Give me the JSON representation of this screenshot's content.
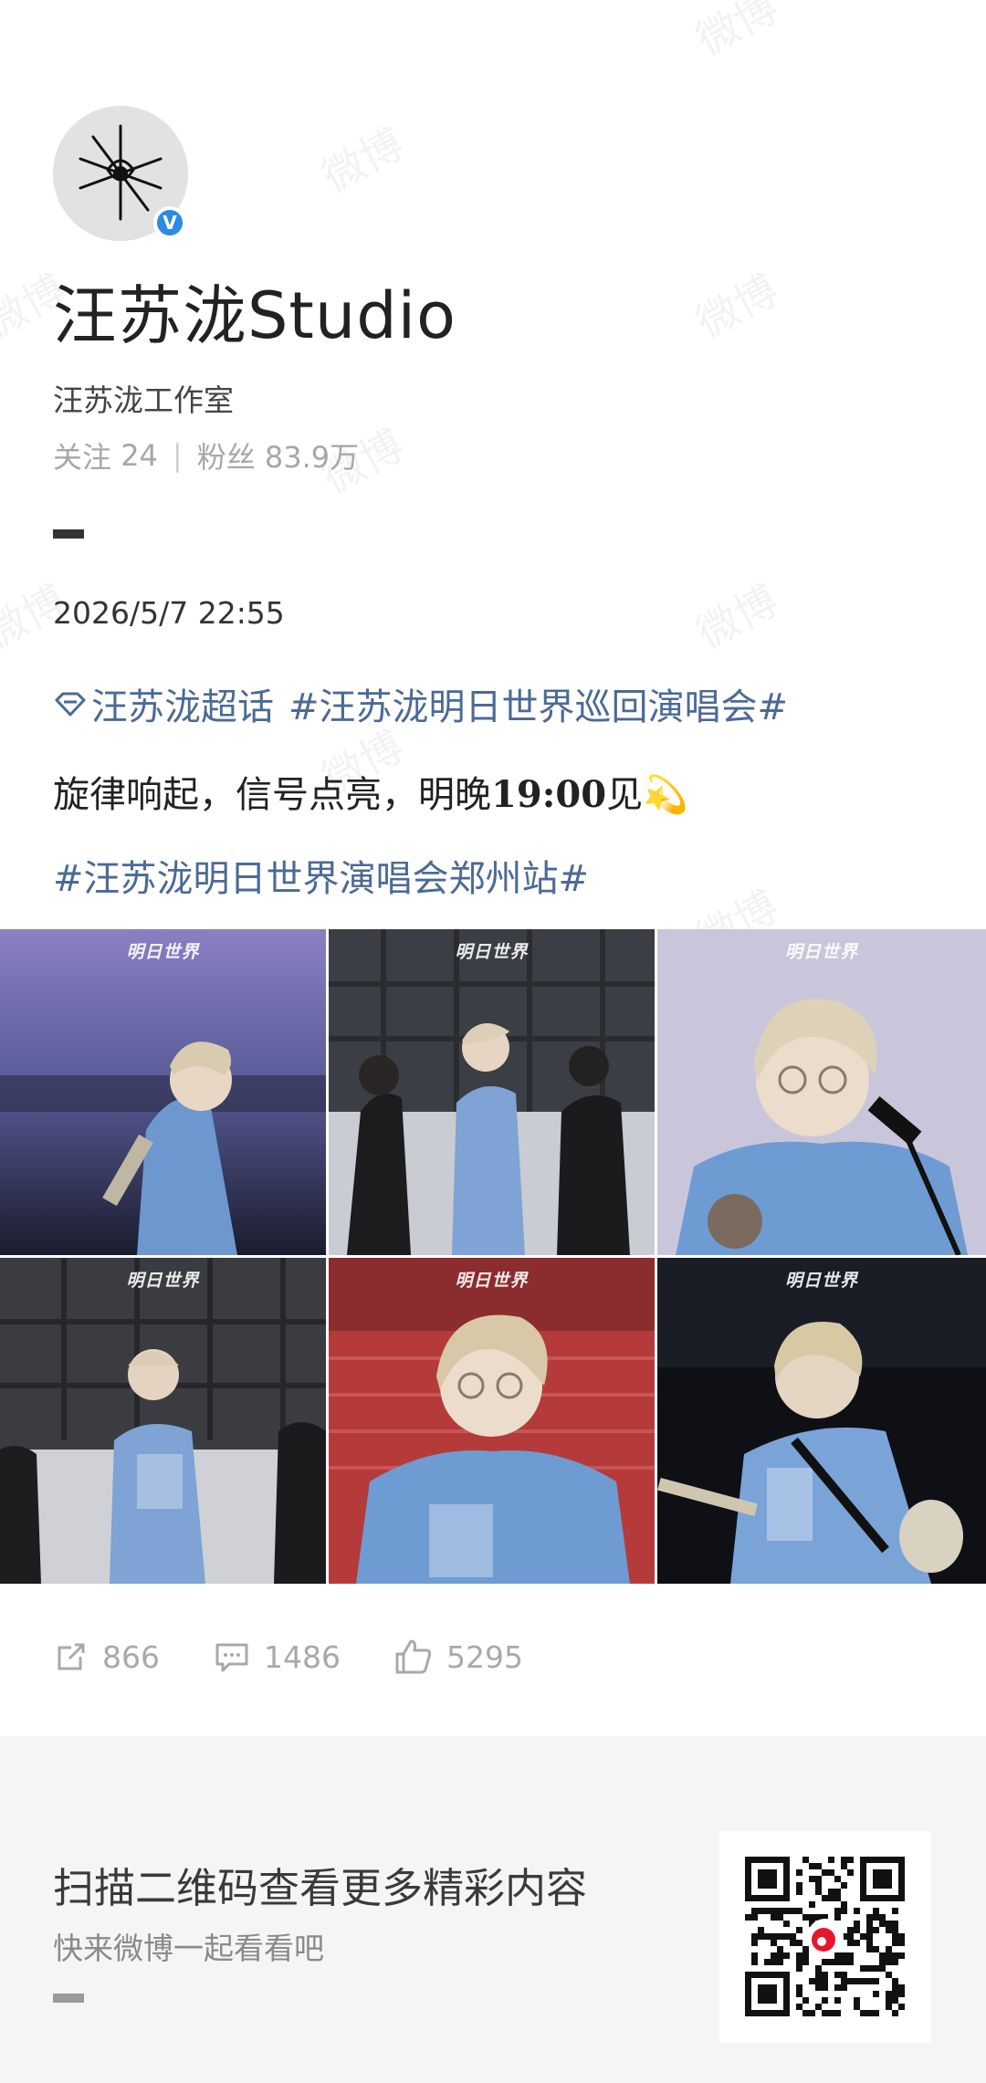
{
  "profile": {
    "name": "汪苏泷Studio",
    "description": "汪苏泷工作室",
    "following_label": "关注",
    "following_count": "24",
    "followers_label": "粉丝",
    "followers_count": "83.9万",
    "verified_badge": "V"
  },
  "post": {
    "date": "2026/5/7 22:55",
    "topic_link": "汪苏泷超话",
    "hashtag_1": "#汪苏泷明日世界巡回演唱会#",
    "text_main": "旋律响起，信号点亮，明晚",
    "text_time": "19:00",
    "text_end": "见",
    "emoji": "💫",
    "hashtag_2": "#汪苏泷明日世界演唱会郑州站#",
    "photo_caption": "明日世界"
  },
  "actions": {
    "repost_count": "866",
    "comment_count": "1486",
    "like_count": "5295"
  },
  "footer": {
    "title": "扫描二维码查看更多精彩内容",
    "subtitle": "快来微博一起看看吧"
  },
  "watermark": "微博",
  "icons": [
    "repost-icon",
    "comment-icon",
    "like-icon",
    "diamond-topic-icon",
    "verified-icon",
    "qr-code-icon"
  ],
  "colors": {
    "link": "#4b6a95",
    "verified": "#2b8ae8",
    "footer_bg": "#f5f5f5",
    "muted": "#a9a9a9"
  }
}
